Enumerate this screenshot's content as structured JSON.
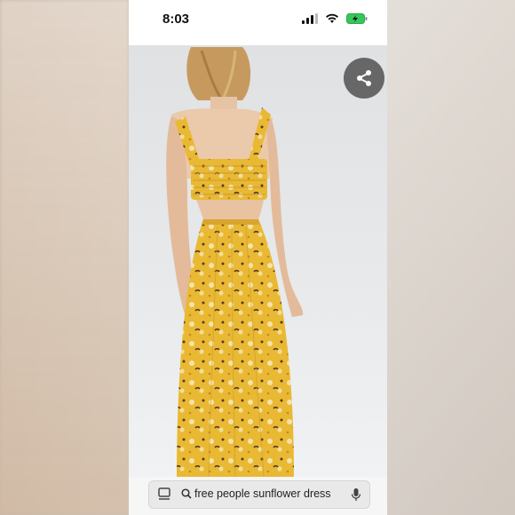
{
  "status_bar": {
    "time": "8:03",
    "icons": [
      "signal-icon",
      "wifi-icon",
      "battery-charging-icon"
    ],
    "battery_color": "#34c759"
  },
  "image": {
    "subject": "woman-back-view-yellow-floral-cutout-maxi-dress",
    "dress_color": "#e9b934",
    "share_icon": "share-icon"
  },
  "search_bar": {
    "left_icon": "lens-tray-icon",
    "search_icon": "search-icon",
    "query": "free people sunflower dress",
    "right_icon": "mic-icon"
  }
}
